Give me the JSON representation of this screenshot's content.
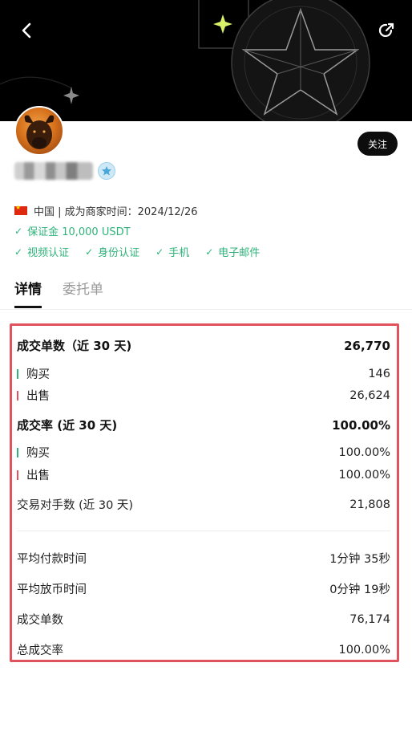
{
  "header": {
    "back_icon": "chevron-left-icon",
    "share_icon": "share-icon"
  },
  "profile": {
    "follow_label": "关注",
    "region_line": "中国 | 成为商家时间：2024/12/26",
    "deposit": "保证金 10,000 USDT",
    "verifications": [
      "视频认证",
      "身份认证",
      "手机",
      "电子邮件"
    ]
  },
  "tabs": [
    {
      "label": "详情",
      "active": true
    },
    {
      "label": "委托单",
      "active": false
    }
  ],
  "stats": {
    "orders_30d": {
      "label": "成交单数（近 30 天)",
      "value": "26,770"
    },
    "orders_buy": {
      "label": "购买",
      "value": "146"
    },
    "orders_sell": {
      "label": "出售",
      "value": "26,624"
    },
    "rate_30d": {
      "label": "成交率 (近 30 天)",
      "value": "100.00%"
    },
    "rate_buy": {
      "label": "购买",
      "value": "100.00%"
    },
    "rate_sell": {
      "label": "出售",
      "value": "100.00%"
    },
    "counterparties": {
      "label": "交易对手数 (近 30 天)",
      "value": "21,808"
    },
    "avg_pay": {
      "label": "平均付款时间",
      "value": "1分钟 35秒"
    },
    "avg_release": {
      "label": "平均放币时间",
      "value": "0分钟 19秒"
    },
    "total_orders": {
      "label": "成交单数",
      "value": "76,174"
    },
    "total_rate": {
      "label": "总成交率",
      "value": "100.00%"
    }
  },
  "colors": {
    "accent_green": "#2fb37a",
    "sell_red": "#e0525c",
    "highlight_border": "#e0525c"
  }
}
